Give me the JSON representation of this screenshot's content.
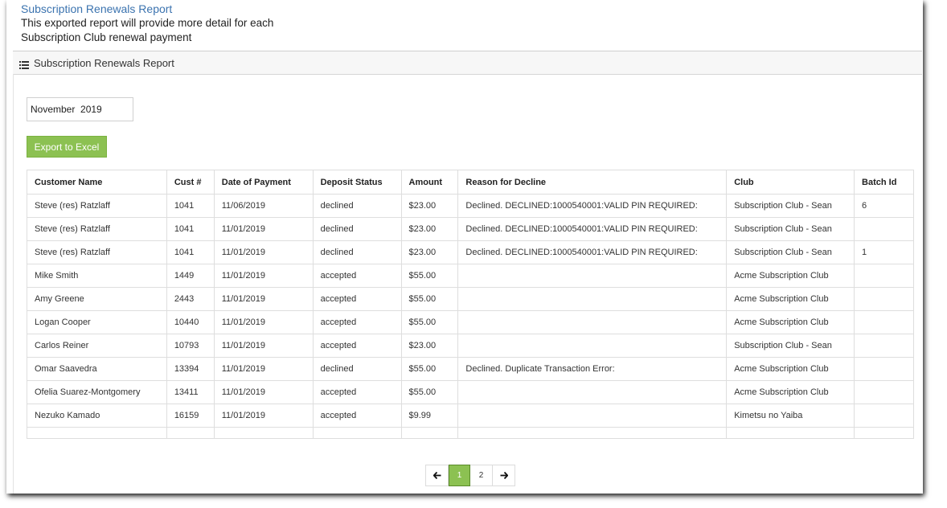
{
  "header": {
    "title": "Subscription Renewals Report",
    "description": "This exported report will provide more detail for each Subscription Club renewal payment"
  },
  "panel": {
    "title": "Subscription Renewals Report",
    "icon": "list-icon"
  },
  "filter": {
    "month_value": "November  2019"
  },
  "actions": {
    "export_label": "Export to Excel"
  },
  "table": {
    "columns": [
      "Customer Name",
      "Cust #",
      "Date of Payment",
      "Deposit Status",
      "Amount",
      "Reason for Decline",
      "Club",
      "Batch Id"
    ],
    "rows": [
      [
        "Steve (res) Ratzlaff",
        "1041",
        "11/06/2019",
        "declined",
        "$23.00",
        "Declined. DECLINED:1000540001:VALID PIN REQUIRED:",
        "Subscription Club - Sean",
        "6"
      ],
      [
        "Steve (res) Ratzlaff",
        "1041",
        "11/01/2019",
        "declined",
        "$23.00",
        "Declined. DECLINED:1000540001:VALID PIN REQUIRED:",
        "Subscription Club - Sean",
        ""
      ],
      [
        "Steve (res) Ratzlaff",
        "1041",
        "11/01/2019",
        "declined",
        "$23.00",
        "Declined. DECLINED:1000540001:VALID PIN REQUIRED:",
        "Subscription Club - Sean",
        "1"
      ],
      [
        "Mike Smith",
        "1449",
        "11/01/2019",
        "accepted",
        "$55.00",
        "",
        "Acme Subscription Club",
        ""
      ],
      [
        "Amy Greene",
        "2443",
        "11/01/2019",
        "accepted",
        "$55.00",
        "",
        "Acme Subscription Club",
        ""
      ],
      [
        "Logan Cooper",
        "10440",
        "11/01/2019",
        "accepted",
        "$55.00",
        "",
        "Acme Subscription Club",
        ""
      ],
      [
        "Carlos Reiner",
        "10793",
        "11/01/2019",
        "accepted",
        "$23.00",
        "",
        "Subscription Club - Sean",
        ""
      ],
      [
        "Omar Saavedra",
        "13394",
        "11/01/2019",
        "declined",
        "$55.00",
        "Declined. Duplicate Transaction Error:",
        "Acme Subscription Club",
        ""
      ],
      [
        "Ofelia Suarez-Montgomery",
        "13411",
        "11/01/2019",
        "accepted",
        "$55.00",
        "",
        "Acme Subscription Club",
        ""
      ],
      [
        "Nezuko Kamado",
        "16159",
        "11/01/2019",
        "accepted",
        "$9.99",
        "",
        "Kimetsu no Yaiba",
        ""
      ]
    ]
  },
  "pagination": {
    "prev_icon": "arrow-left-icon",
    "next_icon": "arrow-right-icon",
    "pages": [
      "1",
      "2"
    ],
    "current": "1"
  },
  "colors": {
    "accent_green": "#8cc152",
    "link_blue": "#3b73af"
  }
}
